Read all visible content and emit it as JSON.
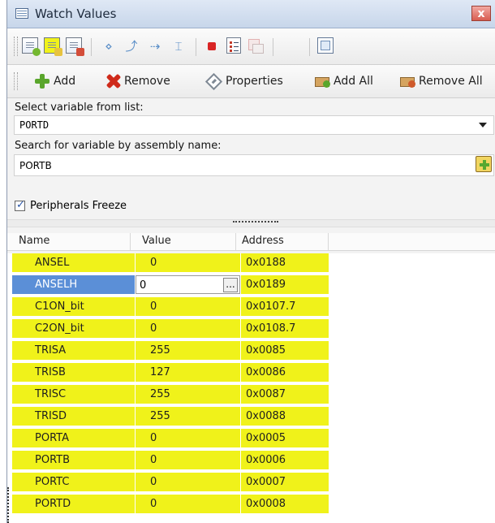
{
  "window": {
    "title": "Watch Values",
    "close_label": "x"
  },
  "toolbar2": {
    "add": "Add",
    "remove": "Remove",
    "properties": "Properties",
    "add_all": "Add All",
    "remove_all": "Remove All"
  },
  "form": {
    "select_label": "Select variable from list:",
    "select_value": "PORTD",
    "search_label": "Search for variable by assembly name:",
    "search_value": "PORTB",
    "checkbox_label": "Peripherals Freeze",
    "checkbox_checked": true
  },
  "grid": {
    "columns": [
      "Name",
      "Value",
      "Address"
    ],
    "rows": [
      {
        "name": "ANSEL",
        "value": "0",
        "address": "0x0188"
      },
      {
        "name": "ANSELH",
        "value": "0",
        "address": "0x0189"
      },
      {
        "name": "C1ON_bit",
        "value": "0",
        "address": "0x0107.7"
      },
      {
        "name": "C2ON_bit",
        "value": "0",
        "address": "0x0108.7"
      },
      {
        "name": "TRISA",
        "value": "255",
        "address": "0x0085"
      },
      {
        "name": "TRISB",
        "value": "127",
        "address": "0x0086"
      },
      {
        "name": "TRISC",
        "value": "255",
        "address": "0x0087"
      },
      {
        "name": "TRISD",
        "value": "255",
        "address": "0x0088"
      },
      {
        "name": "PORTA",
        "value": "0",
        "address": "0x0005"
      },
      {
        "name": "PORTB",
        "value": "0",
        "address": "0x0006"
      },
      {
        "name": "PORTC",
        "value": "0",
        "address": "0x0007"
      },
      {
        "name": "PORTD",
        "value": "0",
        "address": "0x0008"
      }
    ],
    "editor_button": "..."
  },
  "colors": {
    "row_highlight": "#f0f21a",
    "selection": "#5b8fd7"
  }
}
